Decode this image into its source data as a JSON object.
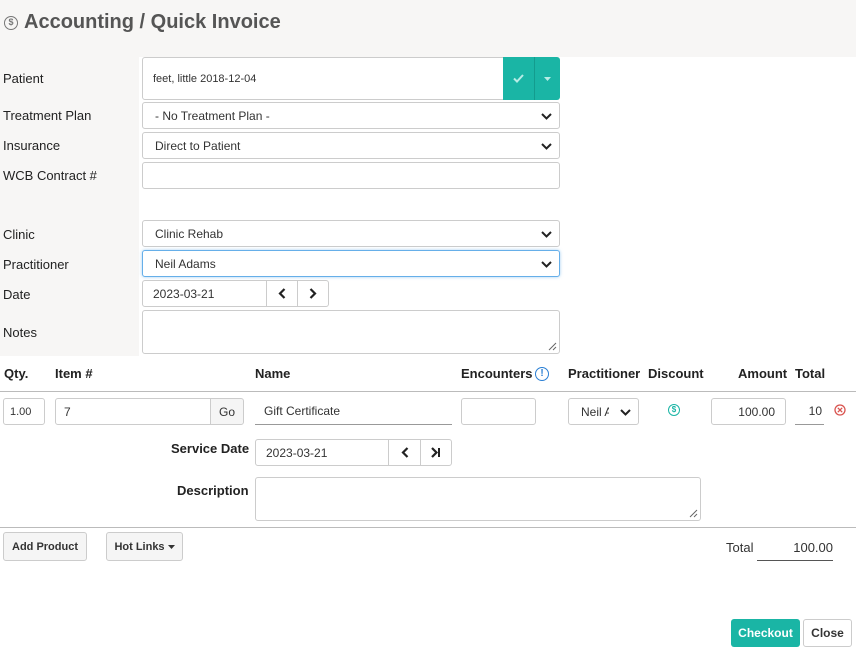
{
  "header": {
    "title": "Accounting / Quick Invoice"
  },
  "form": {
    "patient": {
      "label": "Patient",
      "value": "feet, little 2018-12-04"
    },
    "treatment_plan": {
      "label": "Treatment Plan",
      "value": "- No Treatment Plan -"
    },
    "insurance": {
      "label": "Insurance",
      "value": "Direct to Patient"
    },
    "wcb": {
      "label": "WCB Contract #",
      "value": ""
    },
    "clinic": {
      "label": "Clinic",
      "value": "Clinic Rehab"
    },
    "practitioner": {
      "label": "Practitioner",
      "value": "Neil Adams"
    },
    "date": {
      "label": "Date",
      "value": "2023-03-21"
    },
    "notes": {
      "label": "Notes",
      "value": ""
    }
  },
  "table": {
    "headers": {
      "qty": "Qty.",
      "item": "Item #",
      "name": "Name",
      "encounters": "Encounters",
      "practitioner": "Practitioner",
      "discount": "Discount",
      "amount": "Amount",
      "total": "Total"
    },
    "row": {
      "qty": "1.00",
      "item": "7",
      "go_label": "Go",
      "name": "Gift Certificate",
      "encounters": "",
      "practitioner": "Neil A",
      "amount": "100.00",
      "total": "10",
      "service_date_label": "Service Date",
      "service_date": "2023-03-21",
      "description_label": "Description",
      "description": ""
    }
  },
  "footer": {
    "add_product": "Add Product",
    "hot_links": "Hot Links",
    "total_label": "Total",
    "total_value": "100.00",
    "checkout": "Checkout",
    "close": "Close"
  },
  "colors": {
    "accent": "#1ab5a5",
    "danger": "#d9534f",
    "info": "#2a7fd4"
  }
}
